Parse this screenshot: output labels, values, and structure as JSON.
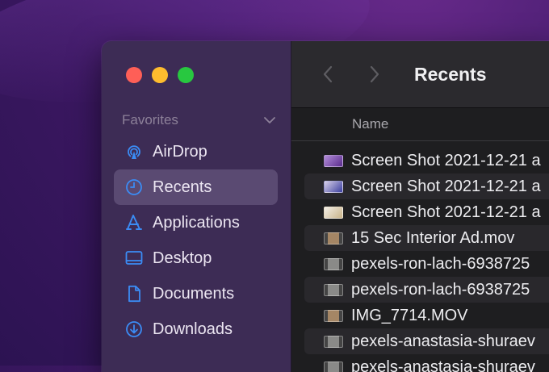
{
  "sidebar": {
    "section_title": "Favorites",
    "items": [
      {
        "label": "AirDrop"
      },
      {
        "label": "Recents"
      },
      {
        "label": "Applications"
      },
      {
        "label": "Desktop"
      },
      {
        "label": "Documents"
      },
      {
        "label": "Downloads"
      }
    ]
  },
  "toolbar": {
    "title": "Recents"
  },
  "list": {
    "column_name": "Name",
    "rows": [
      "Screen Shot 2021-12-21 a",
      "Screen Shot 2021-12-21 a",
      "Screen Shot 2021-12-21 a",
      "15 Sec Interior Ad.mov",
      "pexels-ron-lach-6938725",
      "pexels-ron-lach-6938725",
      "IMG_7714.MOV",
      "pexels-anastasia-shuraev",
      "pexels-anastasia-shuraev"
    ]
  },
  "colors": {
    "accent": "#3b8cf5",
    "sidebar_bg": "#3d2c55",
    "selection": "#5a4a72",
    "traffic_red": "#fe5f57",
    "traffic_yellow": "#febc2e",
    "traffic_green": "#28c840"
  },
  "icons": [
    "airdrop-icon",
    "clock-icon",
    "applications-icon",
    "desktop-icon",
    "document-icon",
    "download-icon",
    "chevron-down-icon",
    "back-chevron-icon",
    "forward-chevron-icon"
  ]
}
